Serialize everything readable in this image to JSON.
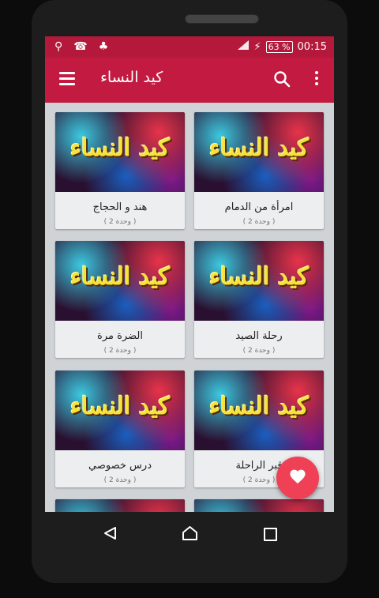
{
  "status_bar": {
    "left_icons": [
      "usb-icon",
      "missed-call-icon",
      "android-icon"
    ],
    "battery": "63 %",
    "time": "00:15"
  },
  "app_bar": {
    "title": "كيد النساء"
  },
  "thumbnail_text": "كيد النساء",
  "cards": [
    {
      "title": "امرأة من الدمام",
      "subtitle": "( 2 وحدة )"
    },
    {
      "title": "هند و الحجاج",
      "subtitle": "( 2 وحدة )"
    },
    {
      "title": "رحلة الصيد",
      "subtitle": "( 2 وحدة )"
    },
    {
      "title": "الضرة مرة",
      "subtitle": "( 2 وحدة )"
    },
    {
      "title": "قبر الراحلة",
      "subtitle": "( 2 وحدة )"
    },
    {
      "title": "درس خصوصي",
      "subtitle": "( 2 وحدة )"
    }
  ],
  "colors": {
    "primary": "#c21a41",
    "status_bar": "#b4183a",
    "fab": "#ef4056"
  }
}
